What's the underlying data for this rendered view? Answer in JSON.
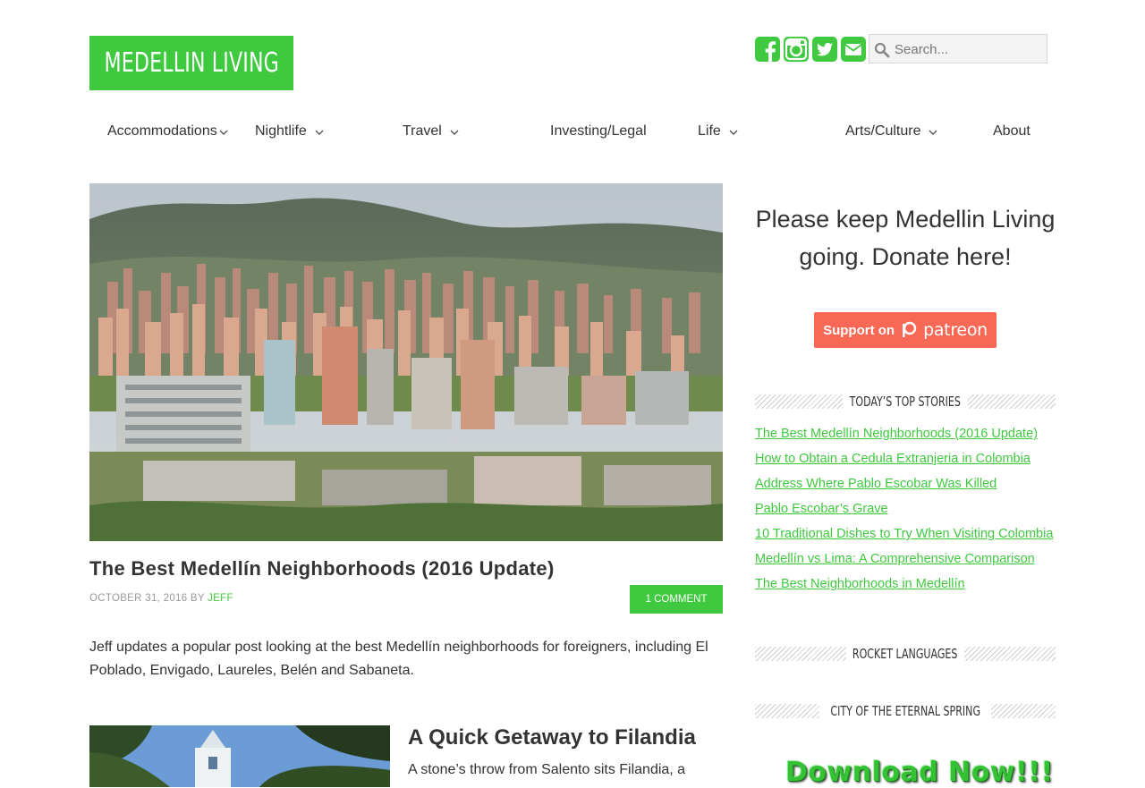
{
  "site": {
    "logo": "MEDELLIN LIVING"
  },
  "header": {
    "social_icons": [
      "facebook-icon",
      "instagram-icon",
      "twitter-icon",
      "envelope-icon"
    ],
    "search_placeholder": "Search..."
  },
  "nav": {
    "items": [
      {
        "label": "Accommodations",
        "has_dropdown": true
      },
      {
        "label": "Nightlife",
        "has_dropdown": true
      },
      {
        "label": "Travel",
        "has_dropdown": true
      },
      {
        "label": "Investing/Legal",
        "has_dropdown": false
      },
      {
        "label": "Life",
        "has_dropdown": true
      },
      {
        "label": "Arts/Culture",
        "has_dropdown": true
      },
      {
        "label": "About",
        "has_dropdown": false
      }
    ]
  },
  "main": {
    "post1": {
      "title": "The Best Medellín Neighborhoods (2016 Update)",
      "date": "OCTOBER 31, 2016",
      "by": "BY",
      "author": "JEFF",
      "comments": "1 COMMENT",
      "excerpt": "Jeff updates a popular post looking at the best Medellín neighborhoods for foreigners, including El Poblado, Envigado, Laureles, Belén and Sabaneta."
    },
    "post2": {
      "title": "A Quick Getaway to Filandia",
      "excerpt": "A stone’s throw from Salento sits Filandia, a"
    }
  },
  "sidebar": {
    "donate_text": "Please keep Medellin Living going. Donate here!",
    "patreon": {
      "support": "Support on",
      "brand": "patreon"
    },
    "top_stories_title": "TODAY’S TOP STORIES",
    "top_stories": [
      "The Best Medellín Neighborhoods (2016 Update)",
      "How to Obtain a Cedula Extranjeria in Colombia",
      "Address Where Pablo Escobar Was Killed",
      "Pablo Escobar’s Grave",
      "10 Traditional Dishes to Try When Visiting Colombia",
      "Medellín vs Lima: A Comprehensive Comparison",
      "The Best Neighborhoods in Medellín"
    ],
    "rocket_title": "ROCKET LANGUAGES",
    "eternal_title": "CITY OF THE ETERNAL SPRING",
    "download_text": "Download Now!!!"
  },
  "colors": {
    "accent": "#3ec93e",
    "patreon": "#f96854",
    "text": "#333333"
  }
}
